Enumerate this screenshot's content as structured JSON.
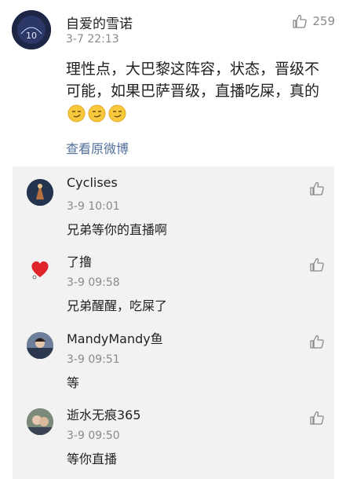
{
  "post": {
    "username": "自爱的雪诺",
    "time": "3-7 22:13",
    "like_count": "259",
    "text": "理性点，大巴黎这阵容，状态，晋级不可能，如果巴萨晋级，直播吃屎，真的",
    "emoji_count": 3,
    "view_original": "查看原微博"
  },
  "replies": [
    {
      "username": "Cyclises",
      "time": "3-9 10:01",
      "text": "兄弟等你的直播啊"
    },
    {
      "username": "了撸",
      "time": "3-9 09:58",
      "text": "兄弟醒醒，吃屎了"
    },
    {
      "username": "MandyMandy鱼",
      "time": "3-9 09:51",
      "text": "等"
    },
    {
      "username": "逝水无痕365",
      "time": "3-9 09:50",
      "text": "等你直播"
    }
  ],
  "colors": {
    "link": "#52709b",
    "meta": "#8a8a8a",
    "reply_bg": "#f2f2f2",
    "emoji": "#f7c83c"
  }
}
